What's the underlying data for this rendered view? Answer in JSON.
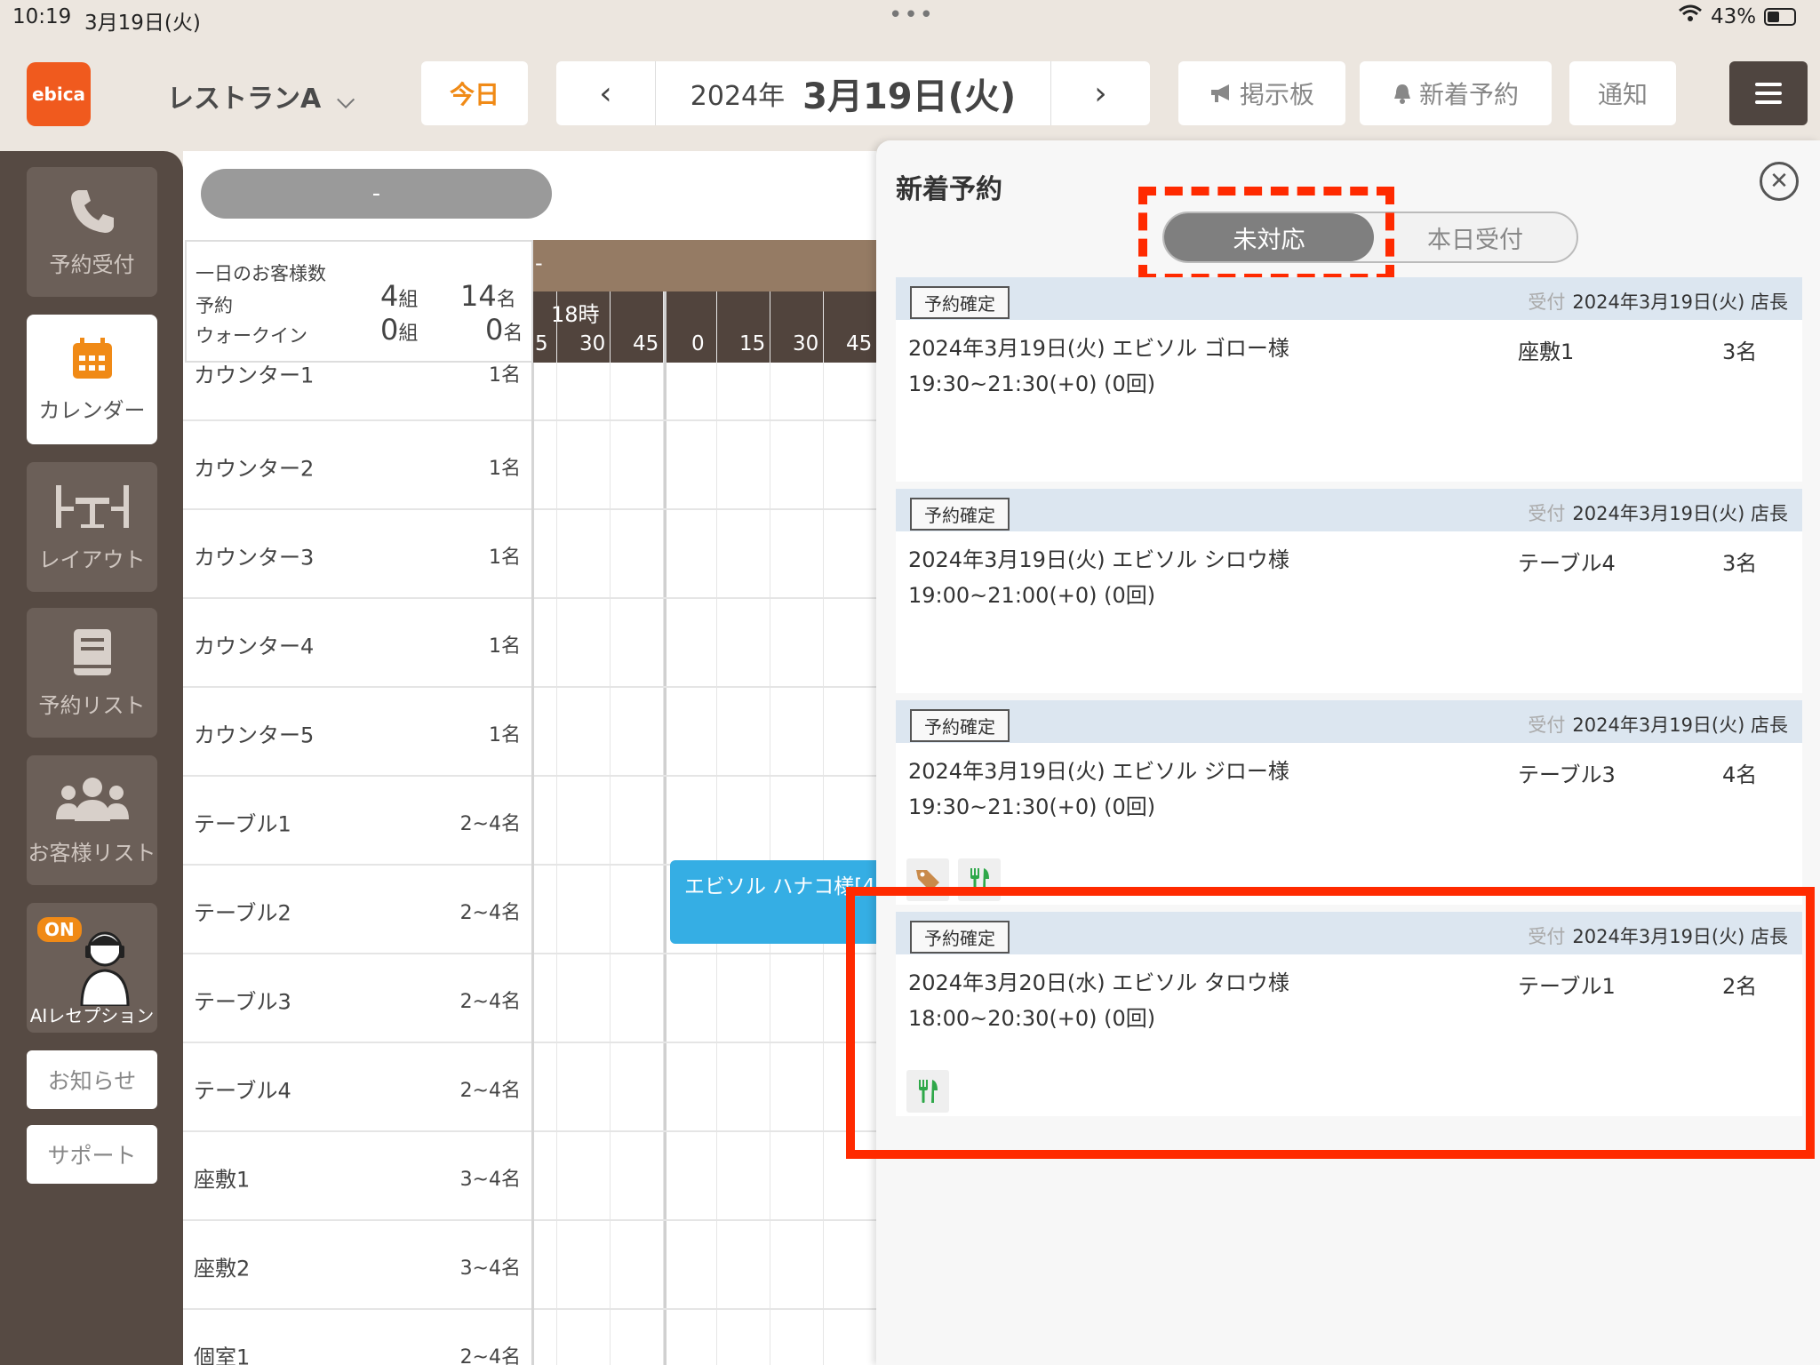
{
  "status": {
    "time": "10:19",
    "date": "3月19日(火)",
    "battery": "43%"
  },
  "header": {
    "logo": "ebica",
    "restaurant": "レストランA",
    "today": "今日",
    "date_year": "2024年",
    "date_main": "3月19日(火)",
    "board": "掲示板",
    "new_reservations": "新着予約",
    "notifications": "通知"
  },
  "sidebar": {
    "reserve": "予約受付",
    "calendar": "カレンダー",
    "layout": "レイアウト",
    "reservation_list": "予約リスト",
    "customer_list": "お客様リスト",
    "ai_badge": "ON",
    "ai": "AIレセプション",
    "news": "お知らせ",
    "support": "サポート"
  },
  "calendar": {
    "filter": "-",
    "stats": {
      "title": "一日のお客様数",
      "reserve_label": "予約",
      "walkin_label": "ウォークイン",
      "reserve_groups": "4",
      "reserve_people": "14",
      "walkin_groups": "0",
      "walkin_people": "0",
      "unit_groups": "組",
      "unit_people": "名"
    },
    "head_dash": "-",
    "hour_label": "18時",
    "minutes": [
      "5",
      "30",
      "45",
      "0",
      "15",
      "30",
      "45"
    ],
    "rows": [
      {
        "name": "カウンター1",
        "cap": "1名"
      },
      {
        "name": "カウンター2",
        "cap": "1名"
      },
      {
        "name": "カウンター3",
        "cap": "1名"
      },
      {
        "name": "カウンター4",
        "cap": "1名"
      },
      {
        "name": "カウンター5",
        "cap": "1名"
      },
      {
        "name": "テーブル1",
        "cap": "2~4名"
      },
      {
        "name": "テーブル2",
        "cap": "2~4名"
      },
      {
        "name": "テーブル3",
        "cap": "2~4名"
      },
      {
        "name": "テーブル4",
        "cap": "2~4名"
      },
      {
        "name": "座敷1",
        "cap": "3~4名"
      },
      {
        "name": "座敷2",
        "cap": "3~4名"
      },
      {
        "name": "個室1",
        "cap": "2~4名"
      }
    ],
    "block": "エビソル ハナコ様[4"
  },
  "panel": {
    "title": "新着予約",
    "tab_pending": "未対応",
    "tab_today": "本日受付",
    "received_label": "受付",
    "cards": [
      {
        "badge": "予約確定",
        "received": "2024年3月19日(火) 店長",
        "line1": "2024年3月19日(火)  エビソル ゴロー様",
        "line2": "19:30~21:30(+0)  (0回)",
        "seat": "座敷1",
        "people": "3名"
      },
      {
        "badge": "予約確定",
        "received": "2024年3月19日(火) 店長",
        "line1": "2024年3月19日(火)  エビソル シロウ様",
        "line2": "19:00~21:00(+0)  (0回)",
        "seat": "テーブル4",
        "people": "3名"
      },
      {
        "badge": "予約確定",
        "received": "2024年3月19日(火) 店長",
        "line1": "2024年3月19日(火)  エビソル ジロー様",
        "line2": "19:30~21:30(+0)  (0回)",
        "seat": "テーブル3",
        "people": "4名"
      },
      {
        "badge": "予約確定",
        "received": "2024年3月19日(火) 店長",
        "line1": "2024年3月20日(水)  エビソル タロウ様",
        "line2": "18:00~20:30(+0)  (0回)",
        "seat": "テーブル1",
        "people": "2名"
      }
    ]
  },
  "colors": {
    "accent": "#f08a16",
    "brand": "#f05a1e",
    "highlight": "#ff2a00",
    "block": "#35aee4"
  },
  "icons": [
    "phone-icon",
    "calendar-icon",
    "layout-icon",
    "book-icon",
    "people-icon",
    "megaphone-icon",
    "bell-icon",
    "menu-icon",
    "close-icon",
    "tag-icon",
    "utensils-icon"
  ]
}
